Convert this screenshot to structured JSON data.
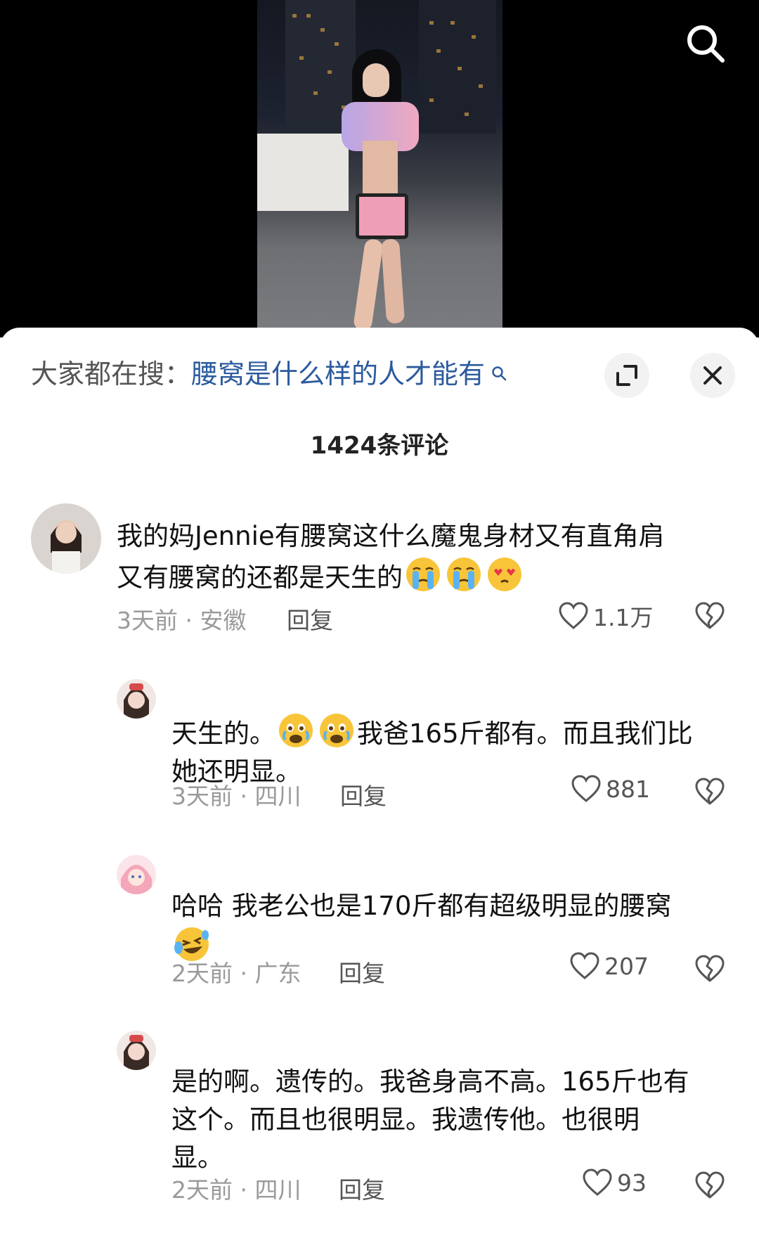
{
  "topbar": {
    "search_icon": "search-icon"
  },
  "sheet": {
    "hot_search_prefix": "大家都在搜：",
    "hot_search_term": "腰窝是什么样的人才能有",
    "hot_search_icon": "search-small-icon",
    "expand_icon": "expand-icon",
    "close_icon": "close-icon",
    "comment_count": "1424条评论"
  },
  "comments": [
    {
      "line1": "我的妈Jennie有腰窝这什么魔鬼身材又有直角肩",
      "line2": "又有腰窝的还都是天生的",
      "emojis": [
        "crying-emoji",
        "crying-emoji",
        "heart-eyes-emoji"
      ],
      "meta": "3天前 · 安徽",
      "reply": "回复",
      "likes": "1.1万"
    },
    {
      "text_a": "天生的。",
      "text_b": "我爸165斤都有。而且我们比",
      "line2": "她还明显。",
      "emojis": [
        "tearful-emoji",
        "tearful-emoji"
      ],
      "meta": "3天前 · 四川",
      "reply": "回复",
      "likes": "881"
    },
    {
      "line1": "哈哈 我老公也是170斤都有超级明显的腰窝",
      "emojis": [
        "laughing-tears-emoji"
      ],
      "meta": "2天前 · 广东",
      "reply": "回复",
      "likes": "207"
    },
    {
      "line1": "是的啊。遗传的。我爸身高不高。165斤也有",
      "line2": "这个。而且也很明显。我遗传他。也很明",
      "line3": "显。",
      "meta": "2天前 · 四川",
      "reply": "回复",
      "likes": "93"
    }
  ],
  "colors": {
    "link": "#2b5b9e",
    "meta": "#9a9a9a",
    "text": "#111111"
  }
}
